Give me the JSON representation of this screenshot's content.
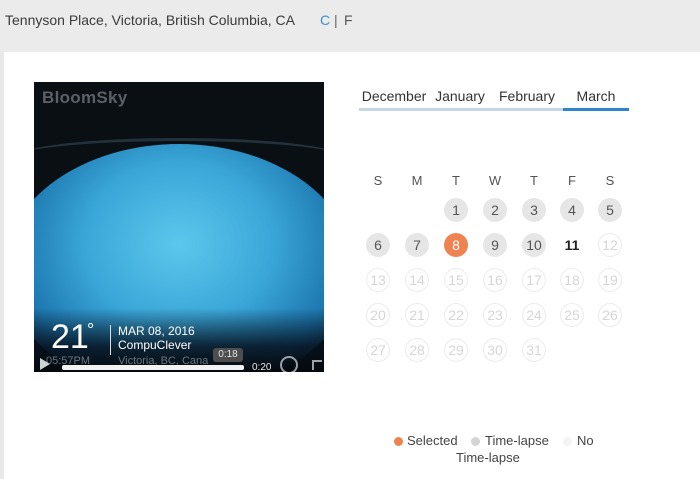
{
  "header": {
    "location": "Tennyson Place, Victoria, British Columbia, CA",
    "unit_c": "C",
    "unit_separator": "|",
    "unit_f": "F"
  },
  "video": {
    "brand": "BloomSky",
    "temperature": "21",
    "degree_symbol": "°",
    "date": "MAR 08, 2016",
    "station": "CompuClever",
    "time_text": "05:57PM",
    "place_text": "Victoria, BC, Cana",
    "tooltip_time": "0:18",
    "duration": "0:20",
    "progress": 0.9
  },
  "months": [
    "December",
    "January",
    "February",
    "March"
  ],
  "active_month": "March",
  "weekdays": [
    "S",
    "M",
    "T",
    "W",
    "T",
    "F",
    "S"
  ],
  "days": [
    {
      "n": "1",
      "s": "tl"
    },
    {
      "n": "2",
      "s": "tl"
    },
    {
      "n": "3",
      "s": "tl"
    },
    {
      "n": "4",
      "s": "tl"
    },
    {
      "n": "5",
      "s": "tl"
    },
    {
      "n": "6",
      "s": "tl"
    },
    {
      "n": "7",
      "s": "tl"
    },
    {
      "n": "8",
      "s": "sel"
    },
    {
      "n": "9",
      "s": "tl"
    },
    {
      "n": "10",
      "s": "tl"
    },
    {
      "n": "11",
      "s": "today"
    },
    {
      "n": "12",
      "s": "none"
    },
    {
      "n": "13",
      "s": "none"
    },
    {
      "n": "14",
      "s": "none"
    },
    {
      "n": "15",
      "s": "none"
    },
    {
      "n": "16",
      "s": "none"
    },
    {
      "n": "17",
      "s": "none"
    },
    {
      "n": "18",
      "s": "none"
    },
    {
      "n": "19",
      "s": "none"
    },
    {
      "n": "20",
      "s": "none"
    },
    {
      "n": "21",
      "s": "none"
    },
    {
      "n": "22",
      "s": "none"
    },
    {
      "n": "23",
      "s": "none"
    },
    {
      "n": "24",
      "s": "none"
    },
    {
      "n": "25",
      "s": "none"
    },
    {
      "n": "26",
      "s": "none"
    },
    {
      "n": "27",
      "s": "none"
    },
    {
      "n": "28",
      "s": "none"
    },
    {
      "n": "29",
      "s": "none"
    },
    {
      "n": "30",
      "s": "none"
    },
    {
      "n": "31",
      "s": "none"
    }
  ],
  "legend": {
    "selected": "Selected",
    "timelapse": "Time-lapse",
    "no": "No",
    "no_line2": "Time-lapse"
  },
  "colors": {
    "accent": "#2e86c9",
    "selected": "#ee8351",
    "timelapse": "#e6e6e6"
  }
}
